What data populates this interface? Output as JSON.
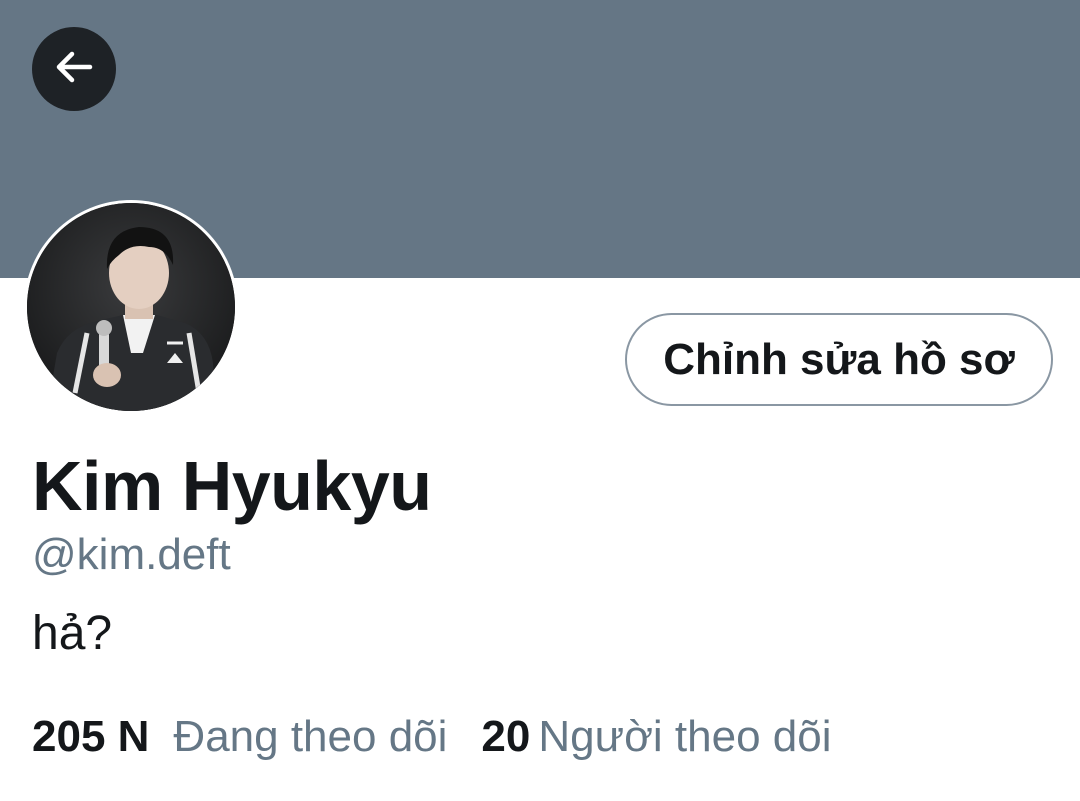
{
  "header": {
    "back_icon": "arrow-left-icon",
    "banner_color": "#657685"
  },
  "profile": {
    "avatar": "profile-photo",
    "edit_button_label": "Chỉnh sửa hồ sơ",
    "display_name": "Kim Hyukyu",
    "handle": "@kim.deft",
    "bio": "hả?"
  },
  "stats": {
    "following_count": "205 N",
    "following_label": "Đang theo dõi",
    "followers_count": "20",
    "followers_label": "Người theo dõi"
  },
  "colors": {
    "text_primary": "#14171a",
    "text_secondary": "#657786",
    "button_border": "#8a97a3"
  }
}
